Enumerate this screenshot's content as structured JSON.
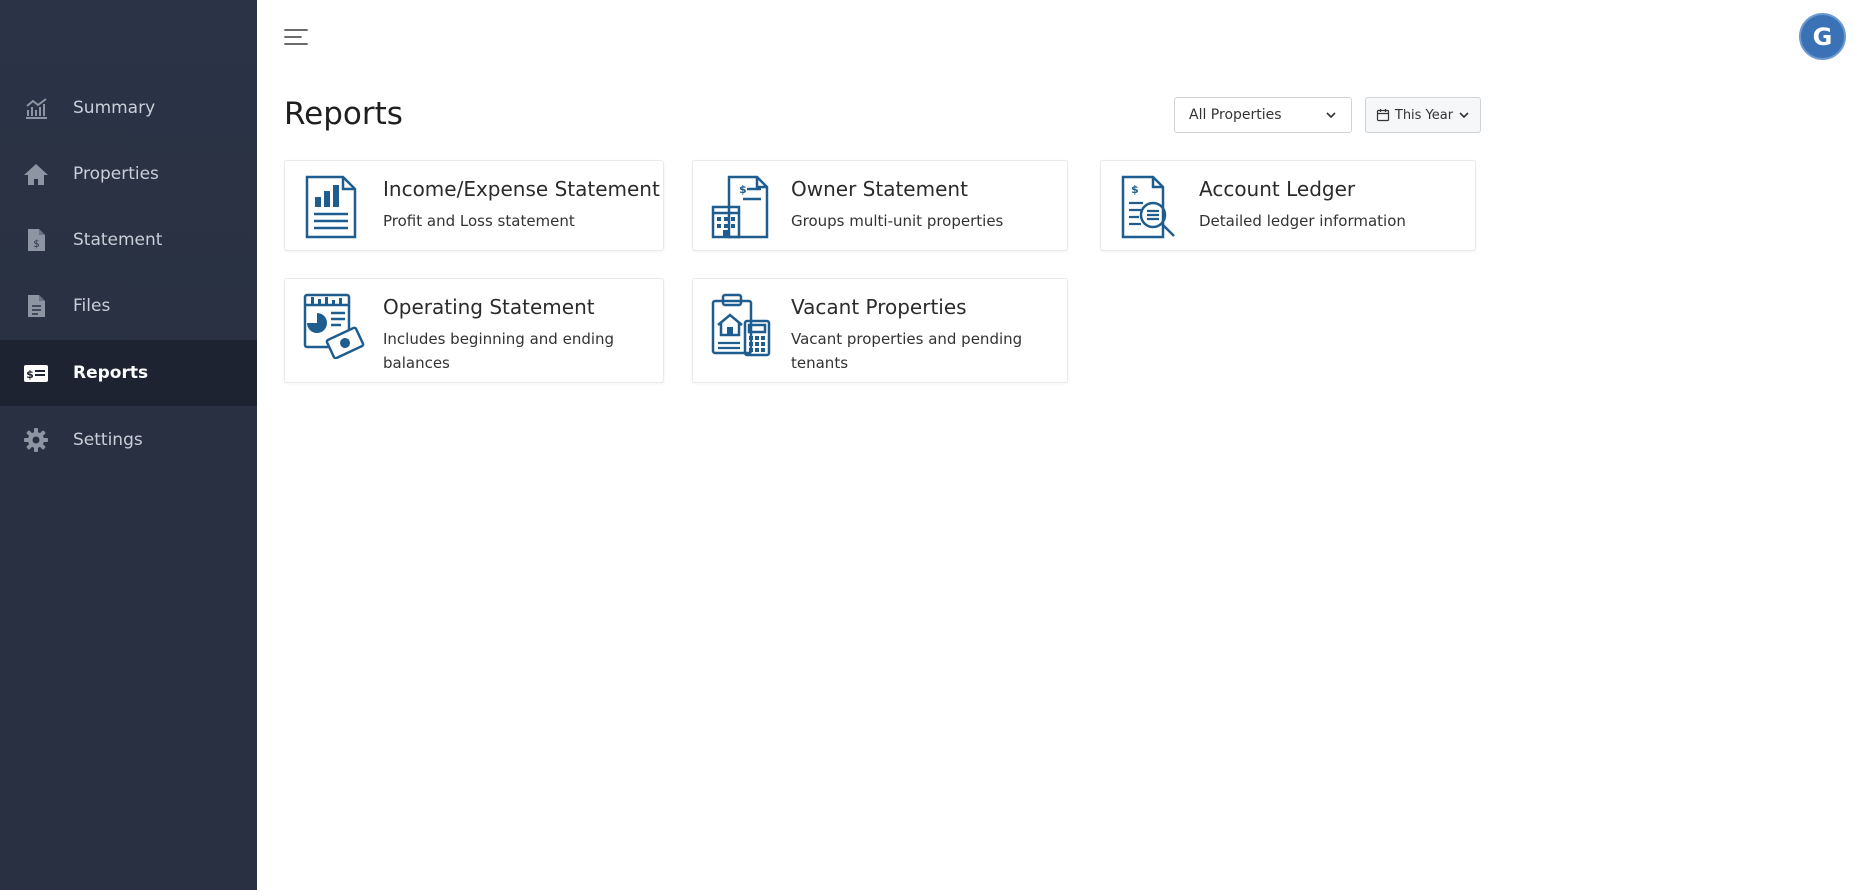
{
  "sidebar": {
    "items": [
      {
        "label": "Summary",
        "icon": "chart-icon"
      },
      {
        "label": "Properties",
        "icon": "home-icon"
      },
      {
        "label": "Statement",
        "icon": "statement-icon"
      },
      {
        "label": "Files",
        "icon": "file-icon"
      },
      {
        "label": "Reports",
        "icon": "reports-icon",
        "active": true
      },
      {
        "label": "Settings",
        "icon": "gear-icon"
      }
    ]
  },
  "header": {
    "avatar_initial": "G"
  },
  "main": {
    "title": "Reports",
    "filters": {
      "properties": "All Properties",
      "period": "This Year"
    },
    "cards": [
      {
        "title": "Income/Expense Statement",
        "description": "Profit and Loss statement",
        "icon": "income-statement-icon"
      },
      {
        "title": "Owner Statement",
        "description": "Groups multi-unit properties",
        "icon": "owner-statement-icon"
      },
      {
        "title": "Account Ledger",
        "description": "Detailed ledger information",
        "icon": "ledger-search-icon"
      },
      {
        "title": "Operating Statement",
        "description": "Includes beginning and ending balances",
        "icon": "operating-statement-icon"
      },
      {
        "title": "Vacant Properties",
        "description": "Vacant properties and pending tenants",
        "icon": "vacant-properties-icon"
      }
    ]
  },
  "colors": {
    "sidebar_bg": "#283042",
    "sidebar_active_bg": "#1d2330",
    "icon_blue": "#1f5d8f",
    "avatar_bg": "#3a72b5"
  }
}
